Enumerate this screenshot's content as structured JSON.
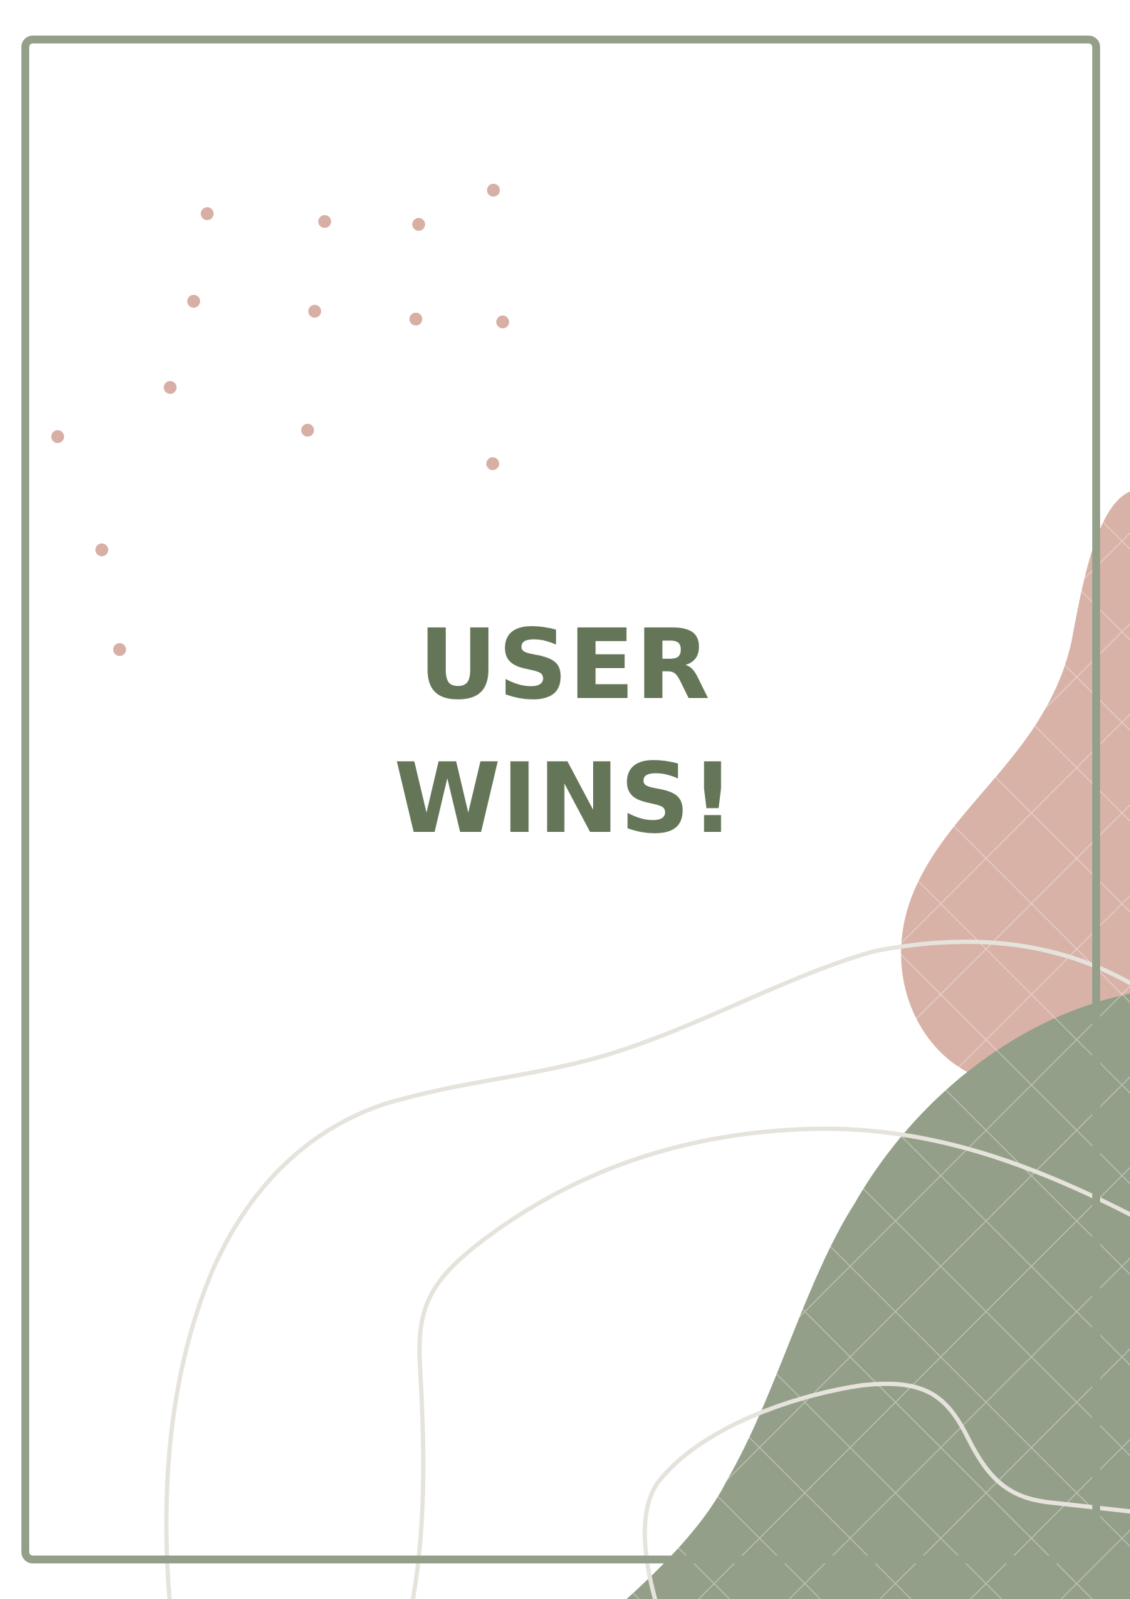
{
  "message": {
    "line1": "USER",
    "line2": "WINS!"
  },
  "colors": {
    "text": "#647657",
    "frame": "#939f89",
    "blob_green": "#939f89",
    "blob_pink": "#d8b2a6",
    "dots": "#d8afa4",
    "curves": "#e6e3dc",
    "background": "#ffffff"
  }
}
